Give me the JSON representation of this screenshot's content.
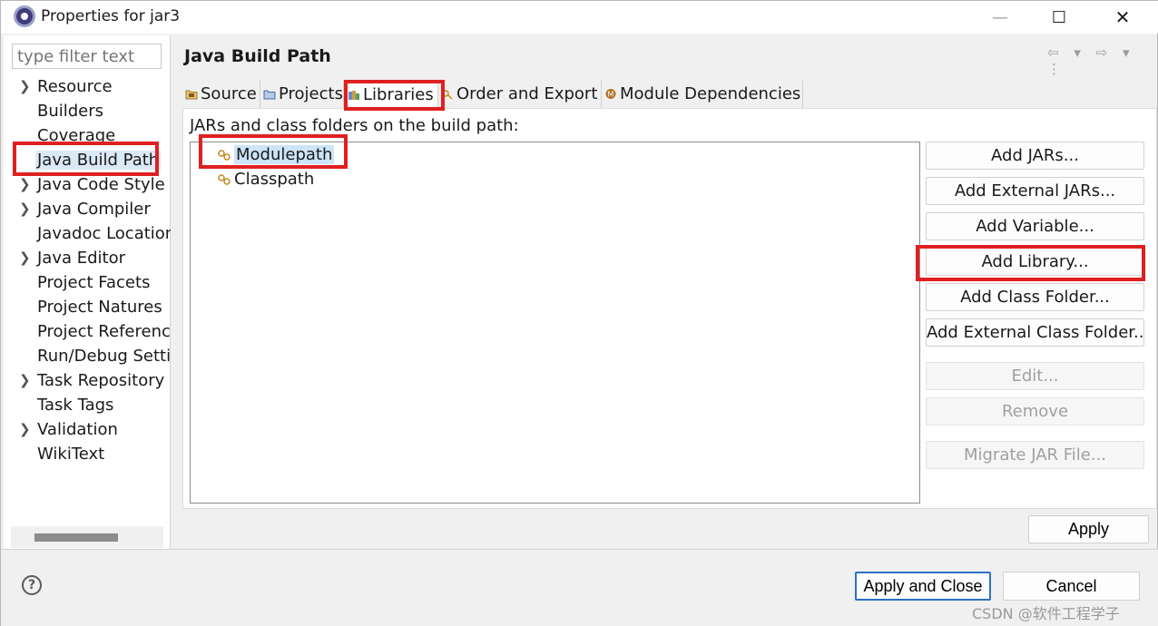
{
  "window": {
    "title": "Properties for jar3",
    "minimize_glyph": "—",
    "maximize_glyph": "☐",
    "close_glyph": "✕"
  },
  "sidebar": {
    "filter_placeholder": "type filter text",
    "items": [
      {
        "label": "Resource",
        "expandable": true
      },
      {
        "label": "Builders",
        "expandable": false
      },
      {
        "label": "Coverage",
        "expandable": false
      },
      {
        "label": "Java Build Path",
        "expandable": false,
        "selected": true
      },
      {
        "label": "Java Code Style",
        "expandable": true
      },
      {
        "label": "Java Compiler",
        "expandable": true
      },
      {
        "label": "Javadoc Location",
        "expandable": false
      },
      {
        "label": "Java Editor",
        "expandable": true
      },
      {
        "label": "Project Facets",
        "expandable": false
      },
      {
        "label": "Project Natures",
        "expandable": false
      },
      {
        "label": "Project References",
        "expandable": false
      },
      {
        "label": "Run/Debug Settings",
        "expandable": false
      },
      {
        "label": "Task Repository",
        "expandable": true
      },
      {
        "label": "Task Tags",
        "expandable": false
      },
      {
        "label": "Validation",
        "expandable": true
      },
      {
        "label": "WikiText",
        "expandable": false
      }
    ]
  },
  "main": {
    "title": "Java Build Path",
    "nav_back_glyph": "⇦ ▾",
    "nav_forward_glyph": "⇨ ▾",
    "nav_menu_glyph": "⋮",
    "tabs": [
      {
        "label": "Source",
        "icon": "source-folder-icon"
      },
      {
        "label": "Projects",
        "icon": "projects-icon"
      },
      {
        "label": "Libraries",
        "icon": "libraries-icon",
        "active": true
      },
      {
        "label": "Order and Export",
        "icon": "order-export-icon"
      },
      {
        "label": "Module Dependencies",
        "icon": "module-icon"
      }
    ],
    "panel_label": "JARs and class folders on the build path:",
    "list_items": [
      {
        "label": "Modulepath",
        "selected": true
      },
      {
        "label": "Classpath",
        "selected": false
      }
    ],
    "buttons": [
      {
        "label": "Add JARs...",
        "enabled": true
      },
      {
        "label": "Add External JARs...",
        "enabled": true
      },
      {
        "label": "Add Variable...",
        "enabled": true
      },
      {
        "label": "Add Library...",
        "enabled": true
      },
      {
        "label": "Add Class Folder...",
        "enabled": true
      },
      {
        "label": "Add External Class Folder...",
        "enabled": true
      },
      {
        "label": "Edit...",
        "enabled": false
      },
      {
        "label": "Remove",
        "enabled": false
      },
      {
        "label": "Migrate JAR File...",
        "enabled": false
      }
    ],
    "apply_label": "Apply"
  },
  "footer": {
    "help_glyph": "?",
    "apply_close_label": "Apply and Close",
    "cancel_label": "Cancel",
    "watermark": "CSDN @软件工程学子"
  },
  "colors": {
    "highlight": "#e02020",
    "selection": "#cce4f7",
    "default_button_border": "#2f6fc4"
  }
}
